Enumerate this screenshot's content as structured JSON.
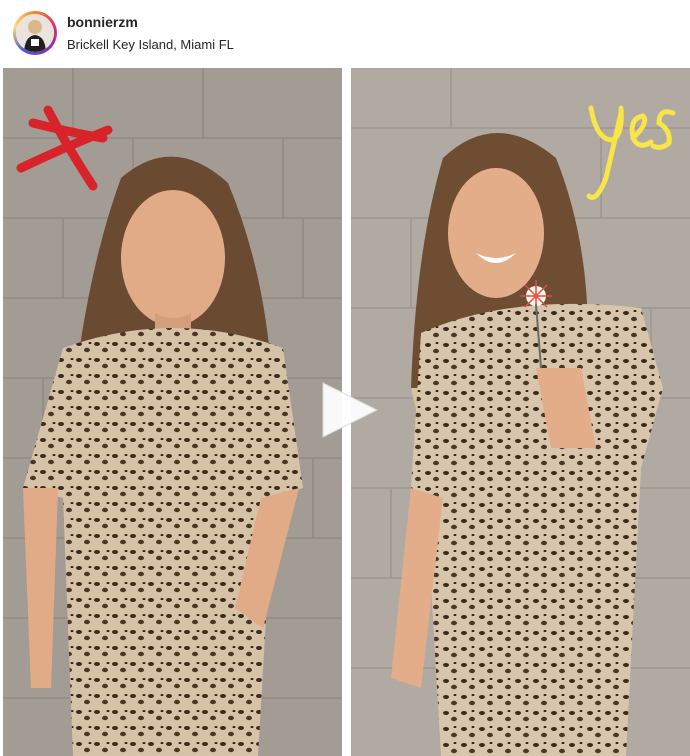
{
  "post": {
    "username": "bonnierzm",
    "location": "Brickell Key Island, Miami FL"
  },
  "images": [
    {
      "annotation": "x-mark-icon",
      "annotation_color": "#d8232a"
    },
    {
      "annotation_text": "yes",
      "annotation_color": "#f7e54a"
    }
  ],
  "icons": {
    "play": "play-icon"
  },
  "colors": {
    "wall": "#a9a29b",
    "outfit": "#c9b49a"
  }
}
